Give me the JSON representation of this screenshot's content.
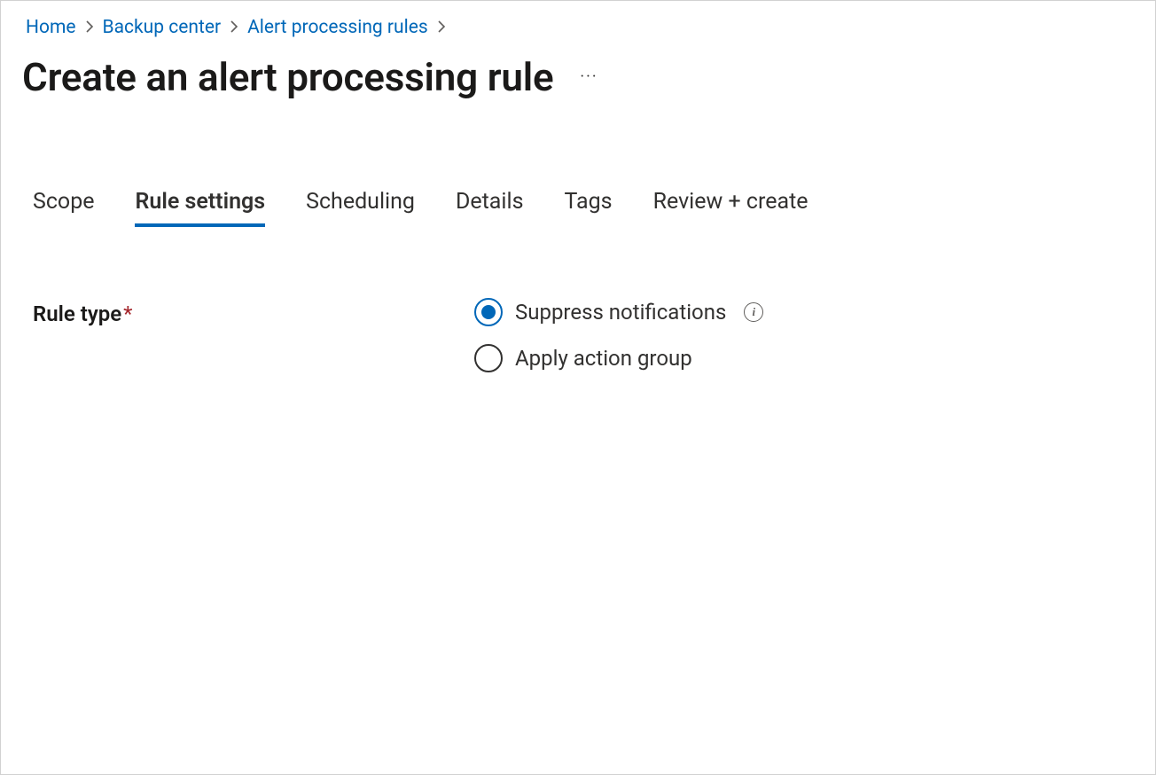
{
  "breadcrumb": {
    "items": [
      {
        "label": "Home"
      },
      {
        "label": "Backup center"
      },
      {
        "label": "Alert processing rules"
      }
    ]
  },
  "header": {
    "title": "Create an alert processing rule"
  },
  "tabs": [
    {
      "label": "Scope",
      "active": false
    },
    {
      "label": "Rule settings",
      "active": true
    },
    {
      "label": "Scheduling",
      "active": false
    },
    {
      "label": "Details",
      "active": false
    },
    {
      "label": "Tags",
      "active": false
    },
    {
      "label": "Review + create",
      "active": false
    }
  ],
  "form": {
    "rule_type": {
      "label": "Rule type",
      "required": true,
      "options": [
        {
          "label": "Suppress notifications",
          "selected": true,
          "has_info": true
        },
        {
          "label": "Apply action group",
          "selected": false,
          "has_info": false
        }
      ]
    }
  },
  "info_glyph": "i",
  "required_glyph": "*",
  "ellipsis_glyph": "···"
}
